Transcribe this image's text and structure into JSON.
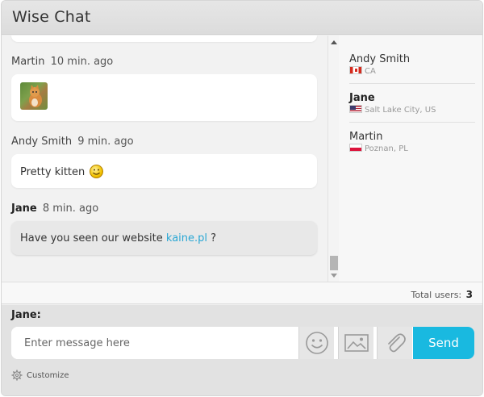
{
  "window": {
    "title": "Wise Chat"
  },
  "messages": [
    {
      "author": "Martin",
      "time": "10 min. ago",
      "type": "image",
      "image_alt": "cat photo"
    },
    {
      "author": "Andy Smith",
      "time": "9 min. ago",
      "type": "text",
      "text": "Pretty kitten",
      "emoticon": "smile-icon"
    },
    {
      "author": "Jane",
      "time": "8 min. ago",
      "type": "text",
      "text_before": "Have you seen our website",
      "link": "kaine.pl",
      "text_after": "?",
      "own": true
    }
  ],
  "users": [
    {
      "name": "Andy Smith",
      "country_flag": "CA",
      "location": "CA",
      "bold": false
    },
    {
      "name": "Jane",
      "country_flag": "US",
      "location": "Salt Lake City, US",
      "bold": true
    },
    {
      "name": "Martin",
      "country_flag": "PL",
      "location": "Poznan, PL",
      "bold": false
    }
  ],
  "stats": {
    "total_label": "Total users:",
    "total_count": "3"
  },
  "composer": {
    "current_user": "Jane:",
    "placeholder": "Enter message here",
    "send_label": "Send",
    "customize_label": "Customize"
  },
  "colors": {
    "accent": "#19b9e0",
    "link": "#2aa7d4"
  }
}
